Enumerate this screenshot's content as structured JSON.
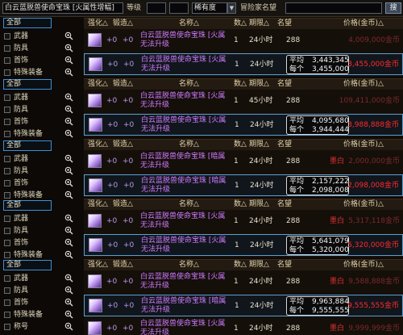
{
  "topbar": {
    "search_value": "白云蓝脱兽使命宝珠 [火属性增幅]",
    "grade_label": "等级",
    "rarity_value": "稀有度",
    "reputation_label": "冒险家名望",
    "search_button": "搜"
  },
  "sidebar": [
    {
      "all": "全部",
      "items": [
        "武器",
        "防具",
        "首饰",
        "特殊装备"
      ]
    },
    {
      "all": "全部",
      "items": [
        "武器",
        "防具",
        "首饰",
        "特殊装备"
      ]
    },
    {
      "all": "全部",
      "items": [
        "武器",
        "防具",
        "首饰",
        "特殊装备"
      ]
    },
    {
      "all": "全部",
      "items": [
        "武器",
        "防具",
        "首饰",
        "特殊装备"
      ]
    },
    {
      "all": "全部",
      "items": [
        "武器",
        "防具",
        "首饰",
        "特殊装备",
        "称号"
      ]
    }
  ],
  "headers": {
    "enhance": "强化△",
    "refine": "锻造△",
    "name": "名称△",
    "qty": "数△",
    "duration": "期限△",
    "fame": "名望",
    "price": "价格(金币)△"
  },
  "sections": [
    {
      "rows": [
        {
          "enhance": "+0",
          "refine": "+0",
          "name": "白云蓝脱兽使命宝珠 [火属",
          "name2": "无法升级",
          "qty": "1",
          "duration": "24小时",
          "fame": "288",
          "price": "4,009,000金币",
          "price_dim": true
        },
        {
          "enhance": "+0",
          "refine": "+0",
          "name": "白云蓝脱兽使命宝珠 [火属",
          "name2": "无法升级",
          "qty": "1",
          "duration": "24小时",
          "fame": "288",
          "avg_label": "平均",
          "avg_value": "3,443,345",
          "each_label": "每个",
          "each_value": "3,455,000",
          "price": "3,455,000金币",
          "selected": true
        }
      ]
    },
    {
      "rows": [
        {
          "enhance": "+0",
          "refine": "+0",
          "name": "白云蓝脱兽使命宝珠 [火属",
          "name2": "无法升级",
          "qty": "1",
          "duration": "45小时",
          "fame": "288",
          "price": "109,411,000金币",
          "price_dim": true
        },
        {
          "enhance": "+0",
          "refine": "+0",
          "name": "白云蓝脱兽使命宝珠 [火属",
          "name2": "无法升级",
          "qty": "1",
          "duration": "24小时",
          "fame": "288",
          "avg_label": "平均",
          "avg_value": "4,095,680",
          "each_label": "每个",
          "each_value": "3,944,444",
          "price": "3,988,888金币",
          "selected": true
        }
      ]
    },
    {
      "rows": [
        {
          "enhance": "+0",
          "refine": "+0",
          "name": "白云蓝脱兽使命宝珠 [暗属",
          "name2": "无法升级",
          "qty": "1",
          "duration": "24小时",
          "fame": "288",
          "seller": "墨白",
          "price": "2,000,000金币",
          "price_dim": true
        },
        {
          "enhance": "+0",
          "refine": "+0",
          "name": "白云蓝脱兽使命宝珠 [暗属",
          "name2": "无法升级",
          "qty": "1",
          "duration": "24小时",
          "fame": "288",
          "avg_label": "平均",
          "avg_value": "2,157,222",
          "each_label": "每个",
          "each_value": "2,098,008",
          "price": "2,098,008金币",
          "selected": true
        }
      ]
    },
    {
      "rows": [
        {
          "enhance": "+0",
          "refine": "+0",
          "name": "白云蓝脱兽使命宝珠 [火属",
          "name2": "无法升级",
          "qty": "1",
          "duration": "24小时",
          "fame": "288",
          "seller": "墨白",
          "price": "5,317,118金币",
          "price_dim": true
        },
        {
          "enhance": "+0",
          "refine": "+0",
          "name": "白云蓝脱兽使命宝珠 [火属",
          "name2": "无法升级",
          "qty": "1",
          "duration": "24小时",
          "fame": "288",
          "avg_label": "平均",
          "avg_value": "5,641,079",
          "each_label": "每个",
          "each_value": "5,320,000",
          "price": "5,320,000金币",
          "selected": true
        }
      ]
    },
    {
      "rows": [
        {
          "enhance": "+0",
          "refine": "+0",
          "name": "白云蓝脱兽使命宝珠 [火属",
          "name2": "无法升级",
          "qty": "1",
          "duration": "24小时",
          "fame": "288",
          "seller": "墨白",
          "price": "9,588,888金币",
          "price_dim": true
        },
        {
          "enhance": "+0",
          "refine": "+0",
          "name": "白云蓝脱兽使命宝珠 [暗属",
          "name2": "无法升级",
          "qty": "1",
          "duration": "24小时",
          "fame": "288",
          "avg_label": "平均",
          "avg_value": "9,963,884",
          "each_label": "每个",
          "each_value": "9,555,555",
          "price": "9,555,555金币",
          "selected": true
        },
        {
          "enhance": "+0",
          "refine": "+0",
          "name": "白云蓝脱兽使命宝珠 [火属",
          "name2": "无法升级",
          "qty": "1",
          "duration": "24小时",
          "fame": "288",
          "seller": "墨白",
          "price": "9,999,999金币",
          "price_dim": true
        }
      ]
    }
  ]
}
